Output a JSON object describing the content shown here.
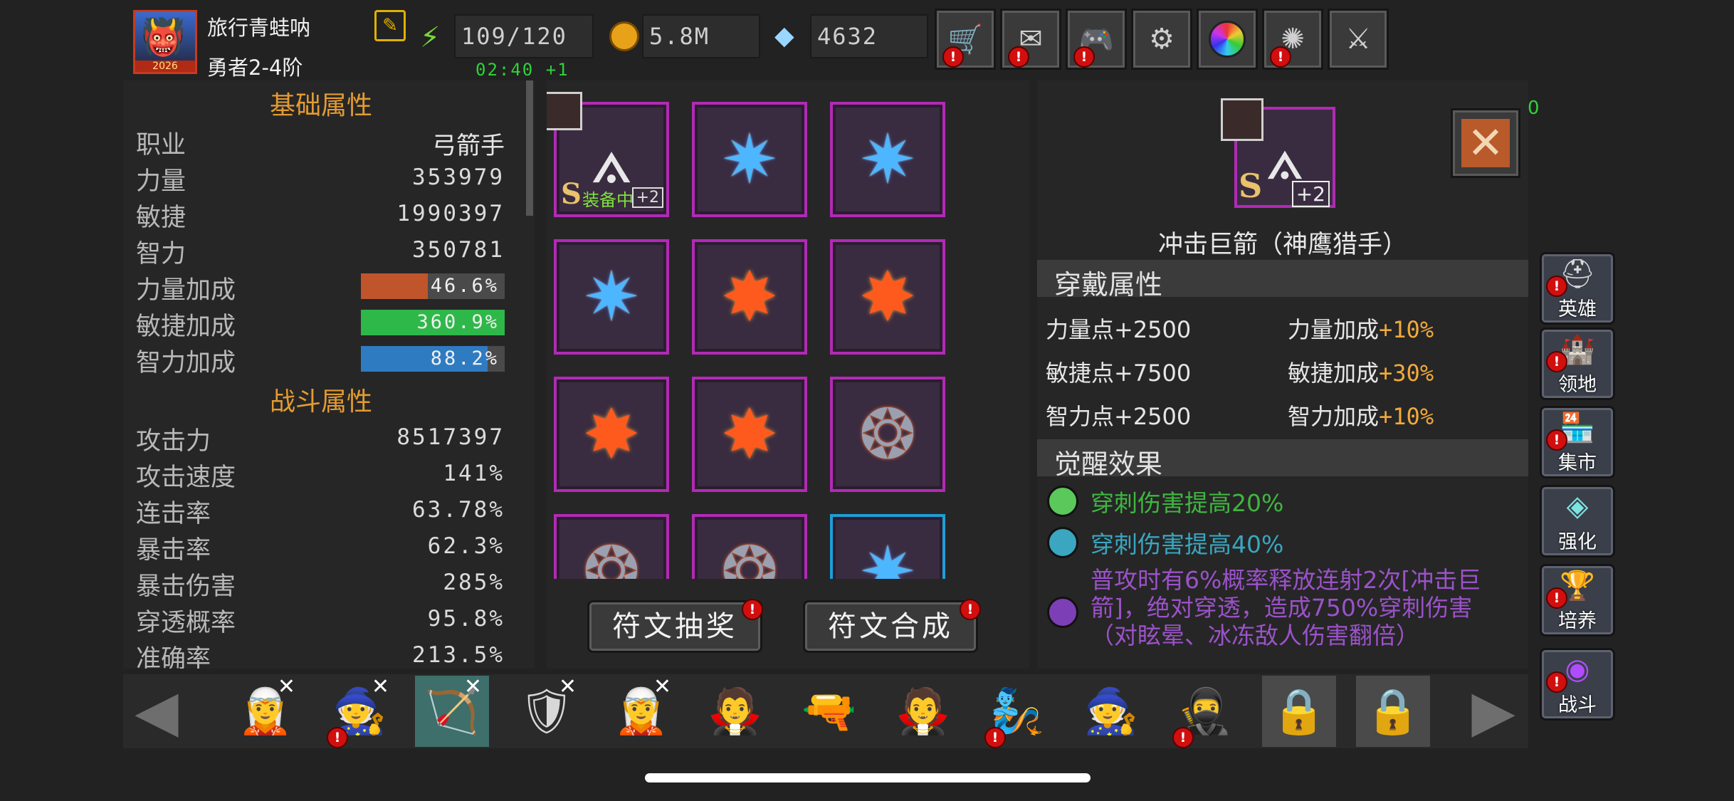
{
  "player": {
    "name": "旅行青蛙呐",
    "rank": "勇者2-4阶",
    "avatar_year": "2026"
  },
  "resources": {
    "energy": "109/120",
    "energy_timer": "02:40 +1",
    "gold": "5.8M",
    "diamonds": "4632"
  },
  "toolbar": [
    {
      "name": "shop",
      "icon": "cart-icon",
      "alert": true
    },
    {
      "name": "mail",
      "icon": "mail-icon",
      "alert": true
    },
    {
      "name": "controller",
      "icon": "gamepad-icon",
      "alert": true
    },
    {
      "name": "settings",
      "icon": "gear-icon",
      "alert": false
    },
    {
      "name": "wheel",
      "icon": "color-wheel-icon",
      "alert": false
    },
    {
      "name": "fireworks",
      "icon": "fireworks-icon",
      "alert": true
    },
    {
      "name": "battle-off",
      "icon": "crossed-swords-icon",
      "alert": false
    }
  ],
  "basic": {
    "title": "基础属性",
    "rows": [
      {
        "label": "职业",
        "value": "弓箭手"
      },
      {
        "label": "力量",
        "value": "353979"
      },
      {
        "label": "敏捷",
        "value": "1990397"
      },
      {
        "label": "智力",
        "value": "350781"
      }
    ],
    "bonuses": [
      {
        "label": "力量加成",
        "value": "46.6%",
        "color": "#c0552c",
        "fill": 0.466
      },
      {
        "label": "敏捷加成",
        "value": "360.9%",
        "color": "#2fb84a",
        "fill": 1.0
      },
      {
        "label": "智力加成",
        "value": "88.2%",
        "color": "#2f7bc2",
        "fill": 0.882
      }
    ]
  },
  "combat": {
    "title": "战斗属性",
    "rows": [
      {
        "label": "攻击力",
        "value": "8517397"
      },
      {
        "label": "攻击速度",
        "value": "141%"
      },
      {
        "label": "连击率",
        "value": "63.78%"
      },
      {
        "label": "暴击率",
        "value": "62.3%"
      },
      {
        "label": "暴击伤害",
        "value": "285%"
      },
      {
        "label": "穿透概率",
        "value": "95.8%"
      },
      {
        "label": "准确率",
        "value": "213.5%"
      }
    ]
  },
  "runes": {
    "equipped_label": "装备中",
    "equipped_grade": "S",
    "equipped_level": "+2",
    "grid": [
      "bow-rune",
      "star-rune",
      "star-rune",
      "star-rune",
      "fire-rune",
      "fire-rune",
      "fire-rune",
      "fire-rune",
      "claw-rune",
      "claw-rune",
      "claw-rune",
      "star-rune"
    ],
    "lottery_label": "符文抽奖",
    "compose_label": "符文合成"
  },
  "detail": {
    "grade": "S",
    "level": "+2",
    "name": "冲击巨箭（神鹰猎手）",
    "corner_text": "0",
    "wear_title": "穿戴属性",
    "wear_attrs": [
      {
        "label": "力量点+2500",
        "bonus_label": "力量加成",
        "bonus_value": "+10%"
      },
      {
        "label": "敏捷点+7500",
        "bonus_label": "敏捷加成",
        "bonus_value": "+30%"
      },
      {
        "label": "智力点+2500",
        "bonus_label": "智力加成",
        "bonus_value": "+10%"
      }
    ],
    "awaken_title": "觉醒效果",
    "effects": [
      {
        "color": "#3fb63f",
        "dot": "#5ac85a",
        "text": "穿刺伤害提高20%"
      },
      {
        "color": "#3aa6c0",
        "dot": "#3aa6c0",
        "text": "穿刺伤害提高40%"
      },
      {
        "color": "#9b52c9",
        "dot": "#7d3fb5",
        "text": "普攻时有6%概率释放连射2次[冲击巨箭]，绝对穿透，造成750%穿刺伤害（对眩晕、冰冻敌人伤害翻倍）"
      }
    ]
  },
  "side_nav": [
    {
      "label": "英雄",
      "icon": "helmet-icon",
      "alert": true
    },
    {
      "label": "领地",
      "icon": "castle-icon",
      "alert": true
    },
    {
      "label": "集市",
      "icon": "market-icon",
      "alert": true
    },
    {
      "label": "强化",
      "icon": "crystal-icon",
      "alert": false
    },
    {
      "label": "培养",
      "icon": "chalice-icon",
      "alert": true
    },
    {
      "label": "战斗",
      "icon": "portal-icon",
      "alert": true
    }
  ],
  "heroes": [
    {
      "name": "hero-1",
      "icon": "warrior-woman-icon",
      "x": true,
      "alert": false
    },
    {
      "name": "hero-2",
      "icon": "ice-mage-icon",
      "x": true,
      "alert": true
    },
    {
      "name": "hero-3",
      "icon": "archer-icon",
      "x": true,
      "alert": false,
      "selected": true
    },
    {
      "name": "hero-4",
      "icon": "paladin-icon",
      "x": true,
      "alert": false
    },
    {
      "name": "hero-5",
      "icon": "elf-archer-icon",
      "x": true,
      "alert": false
    },
    {
      "name": "hero-6",
      "icon": "sorceress-icon",
      "x": false,
      "alert": false
    },
    {
      "name": "hero-7",
      "icon": "gunner-icon",
      "x": false,
      "alert": false
    },
    {
      "name": "hero-8",
      "icon": "vampire-icon",
      "x": false,
      "alert": false
    },
    {
      "name": "hero-9",
      "icon": "frost-spirit-icon",
      "x": false,
      "alert": true
    },
    {
      "name": "hero-10",
      "icon": "wizard-icon",
      "x": false,
      "alert": false
    },
    {
      "name": "hero-11",
      "icon": "dark-knight-icon",
      "x": false,
      "alert": true
    },
    {
      "name": "hero-12",
      "icon": "locked-icon",
      "x": false,
      "alert": false,
      "locked": true
    },
    {
      "name": "hero-13",
      "icon": "locked-icon",
      "x": false,
      "alert": false,
      "locked": true
    }
  ]
}
